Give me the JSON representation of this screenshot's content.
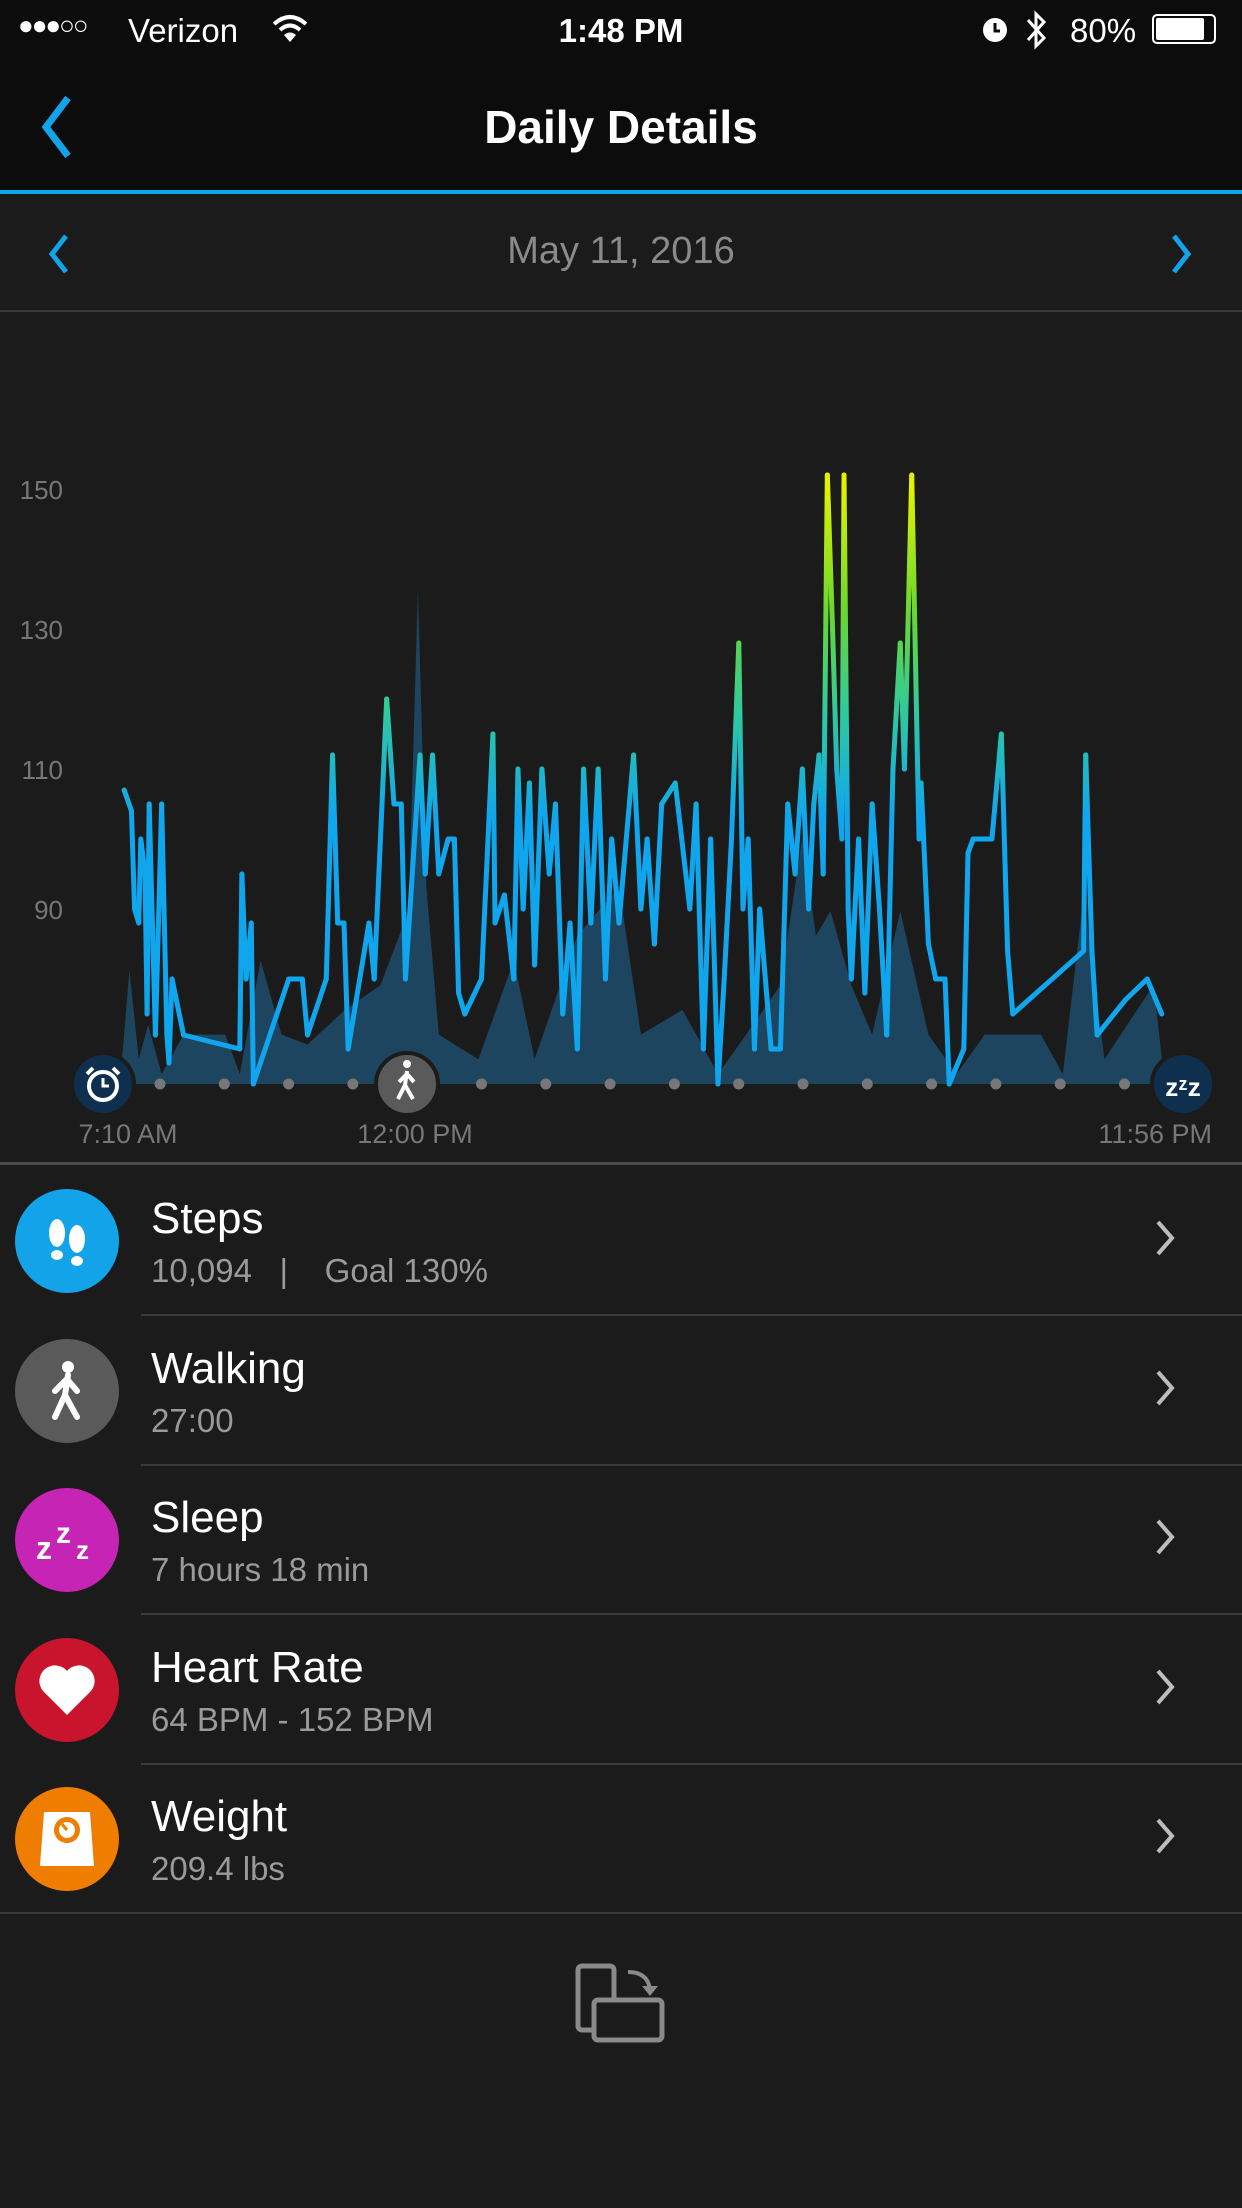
{
  "status_bar": {
    "signal": "●●●○○",
    "carrier": "Verizon",
    "time": "1:48 PM",
    "battery": "80%",
    "icons": [
      "wifi-icon",
      "alarm-icon",
      "bluetooth-icon",
      "battery-icon"
    ]
  },
  "header": {
    "title": "Daily Details",
    "back_icon": "chevron-left-icon"
  },
  "date_nav": {
    "date": "May 11, 2016",
    "prev_icon": "chevron-left-icon",
    "next_icon": "chevron-right-icon"
  },
  "colors": {
    "accent": "#12a3e8",
    "steps_area": "#1d4560",
    "hr_low": "#10a6ee",
    "hr_mid": "#5ad34a",
    "hr_high": "#e0f200"
  },
  "chart_data": {
    "type": "line",
    "y_ticks": [
      "150",
      "130",
      "110",
      "90"
    ],
    "ylim": [
      65,
      150
    ],
    "x_labels": [
      "7:10 AM",
      "12:00 PM",
      "11:56 PM"
    ],
    "xlim": [
      "7:10",
      "23:56"
    ],
    "markers": [
      {
        "time": "7:10",
        "icon": "alarm-clock-icon"
      },
      {
        "time": "12:00",
        "icon": "walking-icon"
      },
      {
        "time": "23:56",
        "icon": "sleep-zzz-icon"
      }
    ],
    "series": [
      {
        "kind": "heart-rate",
        "points": [
          [
            "7:14",
            107
          ],
          [
            "7:21",
            104
          ],
          [
            "7:24",
            90
          ],
          [
            "7:28",
            88
          ],
          [
            "7:30",
            100
          ],
          [
            "7:34",
            95
          ],
          [
            "7:36",
            75
          ],
          [
            "7:38",
            105
          ],
          [
            "7:44",
            72
          ],
          [
            "7:50",
            105
          ],
          [
            "7:55",
            72
          ],
          [
            "7:57",
            68
          ],
          [
            "8:00",
            80
          ],
          [
            "8:11",
            72
          ],
          [
            "9:05",
            70
          ],
          [
            "9:07",
            95
          ],
          [
            "9:11",
            80
          ],
          [
            "9:16",
            88
          ],
          [
            "9:18",
            65
          ],
          [
            "9:52",
            80
          ],
          [
            "10:05",
            80
          ],
          [
            "10:10",
            72
          ],
          [
            "10:28",
            80
          ],
          [
            "10:34",
            112
          ],
          [
            "10:39",
            88
          ],
          [
            "10:45",
            88
          ],
          [
            "10:49",
            70
          ],
          [
            "11:09",
            88
          ],
          [
            "11:14",
            80
          ],
          [
            "11:26",
            120
          ],
          [
            "11:33",
            105
          ],
          [
            "11:40",
            105
          ],
          [
            "11:44",
            80
          ],
          [
            "11:58",
            112
          ],
          [
            "12:03",
            95
          ],
          [
            "12:10",
            112
          ],
          [
            "12:16",
            95
          ],
          [
            "12:25",
            100
          ],
          [
            "12:31",
            100
          ],
          [
            "12:35",
            78
          ],
          [
            "12:41",
            75
          ],
          [
            "12:57",
            80
          ],
          [
            "13:08",
            115
          ],
          [
            "13:10",
            88
          ],
          [
            "13:19",
            92
          ],
          [
            "13:28",
            80
          ],
          [
            "13:32",
            110
          ],
          [
            "13:37",
            90
          ],
          [
            "13:43",
            108
          ],
          [
            "13:48",
            82
          ],
          [
            "13:55",
            110
          ],
          [
            "14:02",
            95
          ],
          [
            "14:08",
            105
          ],
          [
            "14:15",
            75
          ],
          [
            "14:22",
            88
          ],
          [
            "14:29",
            70
          ],
          [
            "14:35",
            110
          ],
          [
            "14:42",
            88
          ],
          [
            "14:49",
            110
          ],
          [
            "14:56",
            80
          ],
          [
            "15:02",
            100
          ],
          [
            "15:09",
            88
          ],
          [
            "15:23",
            112
          ],
          [
            "15:30",
            90
          ],
          [
            "15:36",
            100
          ],
          [
            "15:43",
            85
          ],
          [
            "15:50",
            105
          ],
          [
            "16:03",
            108
          ],
          [
            "16:17",
            90
          ],
          [
            "16:23",
            105
          ],
          [
            "16:30",
            70
          ],
          [
            "16:37",
            100
          ],
          [
            "16:44",
            65
          ],
          [
            "16:50",
            80
          ],
          [
            "16:57",
            100
          ],
          [
            "17:00",
            112
          ],
          [
            "17:04",
            128
          ],
          [
            "17:08",
            90
          ],
          [
            "17:13",
            100
          ],
          [
            "17:19",
            70
          ],
          [
            "17:24",
            90
          ],
          [
            "17:35",
            70
          ],
          [
            "17:44",
            70
          ],
          [
            "17:51",
            105
          ],
          [
            "17:58",
            95
          ],
          [
            "18:05",
            110
          ],
          [
            "18:11",
            90
          ],
          [
            "18:16",
            105
          ],
          [
            "18:21",
            112
          ],
          [
            "18:25",
            95
          ],
          [
            "18:29",
            152
          ],
          [
            "18:34",
            130
          ],
          [
            "18:38",
            110
          ],
          [
            "18:43",
            100
          ],
          [
            "18:45",
            152
          ],
          [
            "18:49",
            90
          ],
          [
            "18:52",
            80
          ],
          [
            "18:59",
            100
          ],
          [
            "19:05",
            78
          ],
          [
            "19:12",
            105
          ],
          [
            "19:19",
            90
          ],
          [
            "19:26",
            72
          ],
          [
            "19:32",
            110
          ],
          [
            "19:39",
            128
          ],
          [
            "19:43",
            110
          ],
          [
            "19:50",
            152
          ],
          [
            "19:53",
            130
          ],
          [
            "19:57",
            100
          ],
          [
            "19:59",
            108
          ],
          [
            "20:06",
            85
          ],
          [
            "20:13",
            80
          ],
          [
            "20:22",
            80
          ],
          [
            "20:26",
            65
          ],
          [
            "20:40",
            70
          ],
          [
            "20:44",
            98
          ],
          [
            "20:49",
            100
          ],
          [
            "21:07",
            100
          ],
          [
            "21:16",
            115
          ],
          [
            "21:22",
            84
          ],
          [
            "21:27",
            75
          ],
          [
            "22:35",
            84
          ],
          [
            "22:37",
            112
          ],
          [
            "22:43",
            84
          ],
          [
            "22:48",
            72
          ],
          [
            "23:15",
            77
          ],
          [
            "23:36",
            80
          ],
          [
            "23:50",
            75
          ]
        ]
      },
      {
        "kind": "steps-activity",
        "relative": true,
        "points": [
          [
            "7:10",
            0
          ],
          [
            "7:19",
            0.23
          ],
          [
            "7:28",
            0.05
          ],
          [
            "7:37",
            0.12
          ],
          [
            "7:50",
            0.02
          ],
          [
            "8:11",
            0.1
          ],
          [
            "8:51",
            0.1
          ],
          [
            "9:05",
            0.02
          ],
          [
            "9:25",
            0.25
          ],
          [
            "9:45",
            0.1
          ],
          [
            "10:10",
            0.08
          ],
          [
            "10:46",
            0.15
          ],
          [
            "11:20",
            0.2
          ],
          [
            "11:47",
            0.35
          ],
          [
            "11:56",
            1.0
          ],
          [
            "12:04",
            0.4
          ],
          [
            "12:16",
            0.1
          ],
          [
            "12:54",
            0.05
          ],
          [
            "13:28",
            0.25
          ],
          [
            "13:48",
            0.05
          ],
          [
            "14:29",
            0.3
          ],
          [
            "15:09",
            0.4
          ],
          [
            "15:30",
            0.1
          ],
          [
            "16:10",
            0.15
          ],
          [
            "16:44",
            0.02
          ],
          [
            "17:11",
            0.1
          ],
          [
            "17:44",
            0.2
          ],
          [
            "18:05",
            0.5
          ],
          [
            "18:18",
            0.3
          ],
          [
            "18:32",
            0.35
          ],
          [
            "18:52",
            0.2
          ],
          [
            "19:12",
            0.1
          ],
          [
            "19:39",
            0.35
          ],
          [
            "20:06",
            0.1
          ],
          [
            "20:33",
            0.02
          ],
          [
            "21:00",
            0.1
          ],
          [
            "21:54",
            0.1
          ],
          [
            "22:15",
            0.02
          ],
          [
            "22:35",
            0.38
          ],
          [
            "22:55",
            0.05
          ],
          [
            "23:42",
            0.2
          ],
          [
            "23:53",
            0
          ]
        ]
      }
    ]
  },
  "metrics": [
    {
      "title": "Steps",
      "subtitle": "10,094   |    Goal 130%",
      "icon": "footprints-icon",
      "color": "#12a3e8"
    },
    {
      "title": "Walking",
      "subtitle": "27:00",
      "icon": "walking-icon",
      "color": "#5a5a5a"
    },
    {
      "title": "Sleep",
      "subtitle": "7 hours 18 min",
      "icon": "sleep-zzz-icon",
      "color": "#c524b4"
    },
    {
      "title": "Heart Rate",
      "subtitle": "64 BPM - 152 BPM",
      "icon": "heart-icon",
      "color": "#c8142c"
    },
    {
      "title": "Weight",
      "subtitle": "209.4 lbs",
      "icon": "scale-icon",
      "color": "#ee7d00"
    }
  ],
  "footer": {
    "icon": "rotate-screen-icon"
  }
}
